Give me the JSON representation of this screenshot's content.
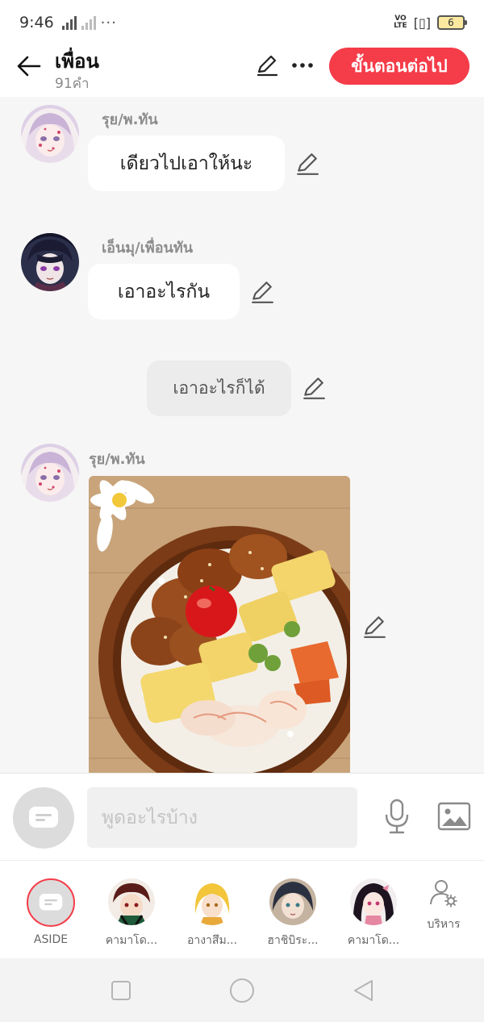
{
  "status_bar": {
    "time": "9:46",
    "network": "4G",
    "battery": "6"
  },
  "header": {
    "title": "เพื่อน",
    "subtitle": "91คำ",
    "next_label": "ขั้นตอนต่อไป"
  },
  "messages": [
    {
      "sender": "รุย/พ.ทัน",
      "text": "เดียวไปเอาให้นะ"
    },
    {
      "sender": "เอ็นมุ/เพื่อนทัน",
      "text": "เอาอะไรกัน"
    },
    {
      "narration": "เอาอะไรก็ได้"
    },
    {
      "sender": "รุย/พ.ทัน",
      "image": "bento-food-photo"
    }
  ],
  "input": {
    "placeholder": "พูดอะไรบ้าง"
  },
  "characters": [
    {
      "label": "ASIDE",
      "selected": true
    },
    {
      "label": "คามาโด..."
    },
    {
      "label": "อางาสึม..."
    },
    {
      "label": "ฮาชิบิระ..."
    },
    {
      "label": "คามาโด..."
    }
  ],
  "manage_label": "บริหาร",
  "colors": {
    "accent": "#f53c49",
    "bubble": "#ffffff",
    "narration_bubble": "#ececec",
    "background": "#f6f6f6"
  }
}
